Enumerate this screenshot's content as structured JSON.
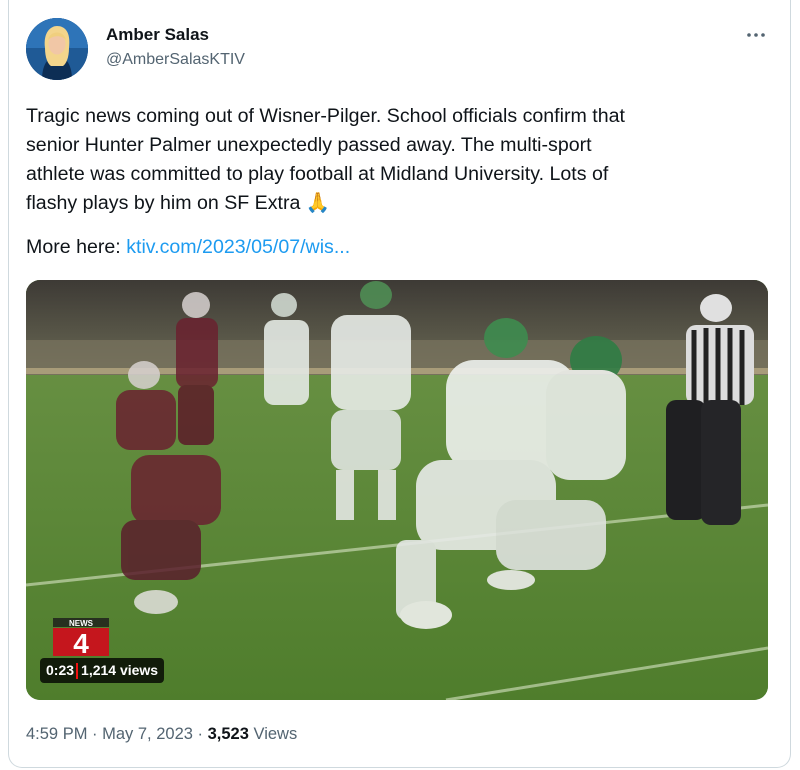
{
  "author": {
    "name": "Amber Salas",
    "handle": "@AmberSalasKTIV"
  },
  "tweet": {
    "text_lines": [
      "Tragic news coming out of Wisner-Pilger. School officials confirm that",
      "senior Hunter Palmer unexpectedly passed away. The multi-sport",
      "athlete was committed to play football at Midland University. Lots of",
      "flashy plays by him on SF Extra"
    ],
    "emoji": "🙏",
    "more_prefix": "More here: ",
    "link_text": "ktiv.com/2023/05/07/wis..."
  },
  "video": {
    "logo_text_top": "NEWS",
    "logo_number": "4",
    "duration": "0:23",
    "views": "1,214 views"
  },
  "meta": {
    "time": "4:59 PM",
    "dot1": " · ",
    "date": "May 7, 2023",
    "dot2": " · ",
    "view_count": "3,523",
    "views_label": " Views"
  },
  "icons": {
    "more": "more-horizontal-icon",
    "play_logo": "news4-logo"
  },
  "colors": {
    "link": "#1d9bf0",
    "secondary": "#536471",
    "primary": "#0f1419"
  }
}
